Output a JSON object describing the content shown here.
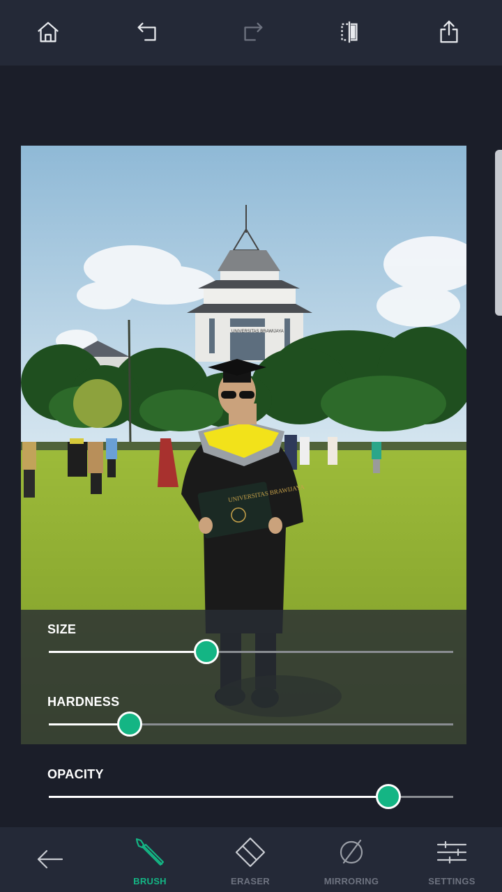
{
  "toolbar": {
    "home": {
      "icon": "home-icon"
    },
    "undo": {
      "icon": "undo-icon"
    },
    "redo": {
      "icon": "redo-icon"
    },
    "compare": {
      "icon": "compare-icon"
    },
    "share": {
      "icon": "share-icon"
    }
  },
  "photo": {
    "sign_text": "UNIVERSITAS BRAWIJAYA",
    "folder_text": "UNIVERSITAS BRAWIJAYA"
  },
  "sliders": [
    {
      "label": "SIZE",
      "value": 0.39
    },
    {
      "label": "HARDNESS",
      "value": 0.2
    },
    {
      "label": "OPACITY",
      "value": 0.84
    }
  ],
  "nav": {
    "back": {
      "icon": "back-arrow-icon"
    },
    "brush": {
      "label": "BRUSH",
      "icon": "brush-icon"
    },
    "eraser": {
      "label": "ERASER",
      "icon": "eraser-icon"
    },
    "mirroring": {
      "label": "MIRRORING",
      "icon": "mirroring-icon"
    },
    "settings": {
      "label": "SETTINGS",
      "icon": "settings-sliders-icon"
    }
  },
  "colors": {
    "accent": "#14b584",
    "toolbar_bg": "#242937",
    "page_bg": "#1b1e29",
    "inactive_label": "#6e7380"
  }
}
